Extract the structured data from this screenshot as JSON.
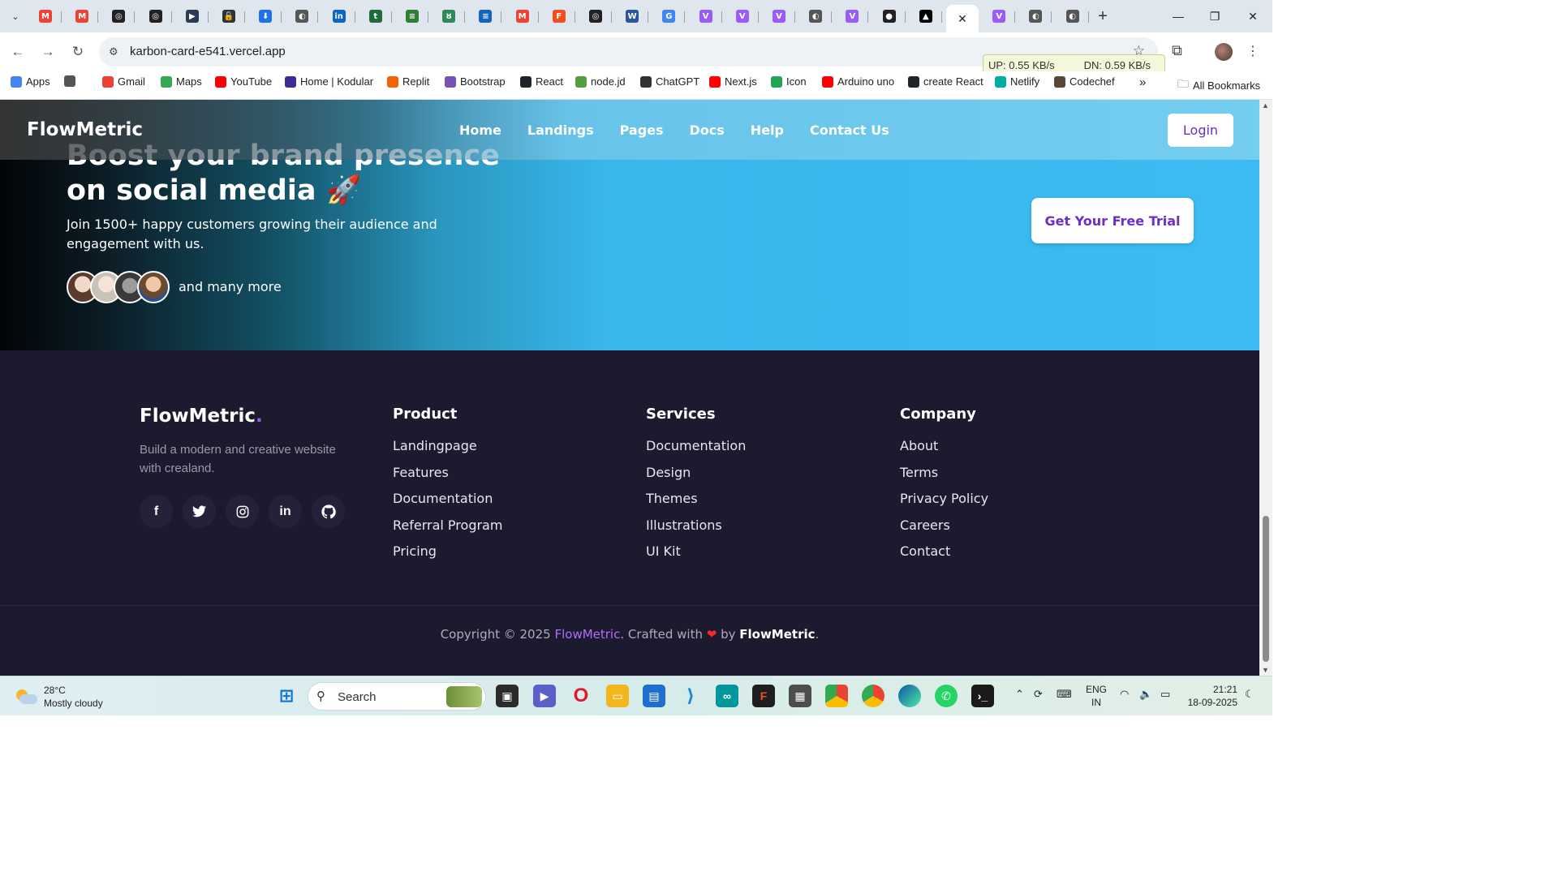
{
  "browser": {
    "tabs": [
      {
        "icon": "gmail-icon",
        "color": "#ea4335",
        "glyph": "M"
      },
      {
        "icon": "gmail-icon",
        "color": "#ea4335",
        "glyph": "M"
      },
      {
        "icon": "chatgpt-icon",
        "color": "#222222",
        "glyph": "◎"
      },
      {
        "icon": "chatgpt-icon",
        "color": "#222222",
        "glyph": "◎"
      },
      {
        "icon": "play-icon",
        "color": "#2b3a55",
        "glyph": "▶"
      },
      {
        "icon": "lock-icon",
        "color": "#333333",
        "glyph": "🔓"
      },
      {
        "icon": "download-icon",
        "color": "#1a73e8",
        "glyph": "⬇"
      },
      {
        "icon": "globe-icon",
        "color": "#555555",
        "glyph": "◐"
      },
      {
        "icon": "linkedin-icon",
        "color": "#0a66c2",
        "glyph": "in"
      },
      {
        "icon": "t-icon",
        "color": "#1d6b3b",
        "glyph": "t"
      },
      {
        "icon": "bars-icon",
        "color": "#2e7d32",
        "glyph": "≡"
      },
      {
        "icon": "leaf-icon",
        "color": "#2e8b57",
        "glyph": "ȣ"
      },
      {
        "icon": "bars-icon",
        "color": "#1565c0",
        "glyph": "≡"
      },
      {
        "icon": "gmail-icon",
        "color": "#ea4335",
        "glyph": "M"
      },
      {
        "icon": "figma-icon",
        "color": "#f24e1e",
        "glyph": "F"
      },
      {
        "icon": "chatgpt-icon",
        "color": "#222222",
        "glyph": "◎"
      },
      {
        "icon": "word-icon",
        "color": "#2b579a",
        "glyph": "W"
      },
      {
        "icon": "google-icon",
        "color": "#4285f4",
        "glyph": "G"
      },
      {
        "icon": "vite-icon",
        "color": "#9a5cf7",
        "glyph": "V"
      },
      {
        "icon": "vite-icon",
        "color": "#9a5cf7",
        "glyph": "V"
      },
      {
        "icon": "vite-icon",
        "color": "#9a5cf7",
        "glyph": "V"
      },
      {
        "icon": "globe-icon",
        "color": "#555555",
        "glyph": "◐"
      },
      {
        "icon": "vite-icon",
        "color": "#9a5cf7",
        "glyph": "V"
      },
      {
        "icon": "github-icon",
        "color": "#222222",
        "glyph": "●"
      },
      {
        "icon": "vercel-icon",
        "color": "#000000",
        "glyph": "▲"
      },
      {
        "icon": "close-icon",
        "color": "#ffffff",
        "glyph": "✕",
        "active": true
      },
      {
        "icon": "vite-icon",
        "color": "#9a5cf7",
        "glyph": "V"
      },
      {
        "icon": "globe-icon",
        "color": "#555555",
        "glyph": "◐"
      },
      {
        "icon": "globe-icon",
        "color": "#555555",
        "glyph": "◐"
      }
    ],
    "url": "karbon-card-e541.vercel.app",
    "netspeed": {
      "up": "UP: 0.55 KB/s",
      "down": "DN: 0.59 KB/s"
    },
    "bookmarks": [
      {
        "label": "Apps",
        "icon": "apps-icon",
        "color": "#4285f4"
      },
      {
        "label": "",
        "icon": "grid-icon",
        "color": "#555555"
      },
      {
        "label": "Gmail",
        "icon": "gmail-icon",
        "color": "#ea4335"
      },
      {
        "label": "Maps",
        "icon": "maps-icon",
        "color": "#34a853"
      },
      {
        "label": "YouTube",
        "icon": "youtube-icon",
        "color": "#ff0000"
      },
      {
        "label": "Home | Kodular",
        "icon": "kodular-icon",
        "color": "#3f2b96"
      },
      {
        "label": "Replit",
        "icon": "replit-icon",
        "color": "#f26207"
      },
      {
        "label": "Bootstrap",
        "icon": "bootstrap-icon",
        "color": "#7952b3"
      },
      {
        "label": "React",
        "icon": "react-icon",
        "color": "#20232a"
      },
      {
        "label": "node.jd",
        "icon": "node-icon",
        "color": "#539e43"
      },
      {
        "label": "ChatGPT",
        "icon": "chatgpt-icon",
        "color": "#333333"
      },
      {
        "label": "Next.js",
        "icon": "youtube-icon",
        "color": "#ff0000"
      },
      {
        "label": "Icon",
        "icon": "icon-icon",
        "color": "#23a455"
      },
      {
        "label": "Arduino uno",
        "icon": "youtube-icon",
        "color": "#ff0000"
      },
      {
        "label": "create React",
        "icon": "react-icon",
        "color": "#20232a"
      },
      {
        "label": "Netlify",
        "icon": "netlify-icon",
        "color": "#00ad9f"
      },
      {
        "label": "Codechef",
        "icon": "codechef-icon",
        "color": "#5b4638"
      }
    ],
    "overflow": "»",
    "all_bookmarks": "All Bookmarks"
  },
  "page": {
    "navbar": {
      "brand": "FlowMetric",
      "links": [
        "Home",
        "Landings",
        "Pages",
        "Docs",
        "Help",
        "Contact Us"
      ],
      "login": "Login"
    },
    "cta": {
      "title_line1": "Boost your brand presence",
      "title_line2": "on social media 🚀",
      "subtitle": "Join 1500+ happy customers growing their audience and engagement with us.",
      "more": "and many more",
      "button": "Get Your Free Trial"
    },
    "footer": {
      "brand": "FlowMetric",
      "brand_dot": ".",
      "description": "Build a modern and creative website with crealand.",
      "socials": [
        {
          "icon": "facebook-icon",
          "glyph": "f"
        },
        {
          "icon": "twitter-icon",
          "glyph": "🐦"
        },
        {
          "icon": "instagram-icon",
          "glyph": "◎"
        },
        {
          "icon": "linkedin-icon",
          "glyph": "in"
        },
        {
          "icon": "github-icon",
          "glyph": "●"
        }
      ],
      "columns": [
        {
          "title": "Product",
          "items": [
            "Landingpage",
            "Features",
            "Documentation",
            "Referral Program",
            "Pricing"
          ]
        },
        {
          "title": "Services",
          "items": [
            "Documentation",
            "Design",
            "Themes",
            "Illustrations",
            "UI Kit"
          ]
        },
        {
          "title": "Company",
          "items": [
            "About",
            "Terms",
            "Privacy Policy",
            "Careers",
            "Contact"
          ]
        }
      ],
      "copyright_prefix": "Copyright © 2025 ",
      "copyright_brand": "FlowMetric",
      "copyright_mid": ". Crafted with ",
      "copyright_heart": "❤",
      "copyright_by": " by ",
      "copyright_by_brand": "FlowMetric",
      "copyright_end": "."
    }
  },
  "taskbar": {
    "weather": {
      "temp": "28°C",
      "condition": "Mostly cloudy"
    },
    "search_placeholder": "Search",
    "lang": {
      "line1": "ENG",
      "line2": "IN"
    },
    "time": "21:21",
    "date": "18-09-2025"
  }
}
